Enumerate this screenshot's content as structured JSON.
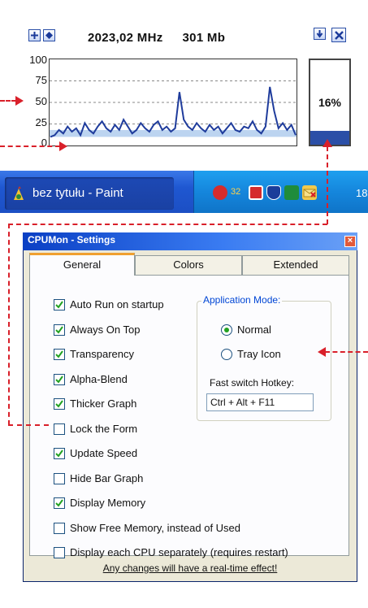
{
  "monitor": {
    "frequency": "2023,02 MHz",
    "memory": "301 Mb",
    "cpu_percent": "16%",
    "cpu_level": 0.16,
    "y_ticks": [
      "100",
      "75",
      "50",
      "25",
      "0"
    ],
    "icons": {
      "add": "plus-icon",
      "diamond": "diamond-icon",
      "down": "arrow-down-icon",
      "close": "close-icon"
    }
  },
  "chart_data": {
    "type": "line",
    "ylim": [
      0,
      100
    ],
    "grid": true,
    "values": [
      10,
      12,
      18,
      14,
      22,
      16,
      20,
      12,
      26,
      18,
      14,
      22,
      28,
      20,
      16,
      24,
      18,
      30,
      22,
      14,
      18,
      26,
      20,
      16,
      24,
      28,
      18,
      22,
      16,
      20,
      62,
      30,
      22,
      18,
      26,
      20,
      16,
      24,
      18,
      22,
      14,
      20,
      26,
      18,
      16,
      22,
      20,
      28,
      18,
      14,
      22,
      68,
      40,
      20,
      26,
      18,
      24,
      12
    ]
  },
  "taskbar": {
    "task_label": "bez tytułu - Paint",
    "clock": "18",
    "tray_number": "32",
    "tray_icons": [
      "red-shield-icon",
      "number-badge-icon",
      "acrobat-icon",
      "shield-icon",
      "green-icon",
      "mail-icon"
    ]
  },
  "dialog": {
    "title": "CPUMon - Settings",
    "tabs": [
      "General",
      "Colors",
      "Extended"
    ],
    "checkboxes": [
      {
        "label": "Auto Run on startup",
        "checked": true
      },
      {
        "label": "Always On Top",
        "checked": true
      },
      {
        "label": "Transparency",
        "checked": true
      },
      {
        "label": "Alpha-Blend",
        "checked": true
      },
      {
        "label": "Thicker Graph",
        "checked": true
      },
      {
        "label": "Lock the Form",
        "checked": false
      },
      {
        "label": "Update Speed",
        "checked": true
      },
      {
        "label": "Hide Bar Graph",
        "checked": false
      },
      {
        "label": "Display Memory",
        "checked": true
      },
      {
        "label": "Show Free Memory, instead of Used",
        "checked": false
      },
      {
        "label": "Display each CPU separately (requires restart)",
        "checked": false
      }
    ],
    "mode_group_title": "Application Mode:",
    "modes": [
      {
        "label": "Normal",
        "selected": true
      },
      {
        "label": "Tray Icon",
        "selected": false
      }
    ],
    "hotkey_label": "Fast switch Hotkey:",
    "hotkey_value": "Ctrl + Alt + F11",
    "footer": "Any changes will have a real-time effect!"
  },
  "colors": {
    "graph_line": "#1f3c9c",
    "graph_fill_band": "#bcd4f0",
    "bar_fill": "#2b4fa7",
    "annotation": "#d9202a"
  }
}
